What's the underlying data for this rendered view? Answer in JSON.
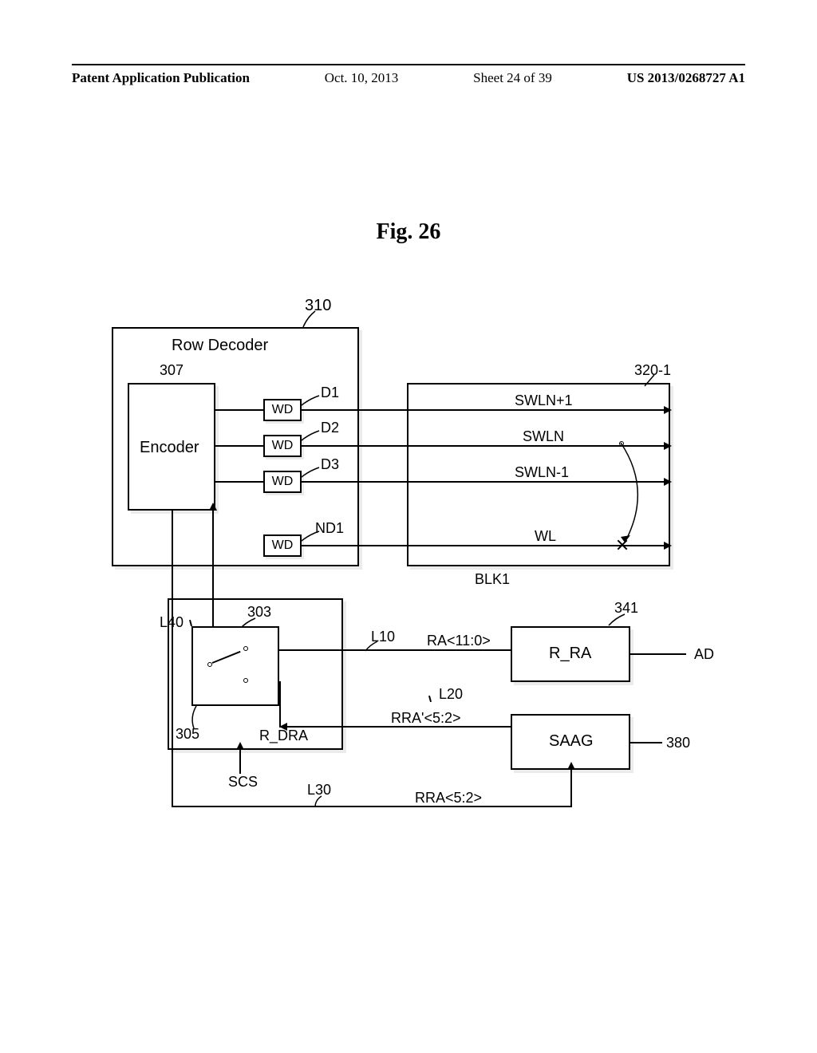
{
  "header": {
    "left": "Patent Application Publication",
    "date": "Oct. 10, 2013",
    "sheet": "Sheet 24 of 39",
    "right": "US 2013/0268727 A1"
  },
  "figure_title": "Fig. 26",
  "blocks": {
    "row_decoder": {
      "ref": "310",
      "title": "Row Decoder"
    },
    "encoder": {
      "ref": "307",
      "title": "Encoder"
    },
    "wd_label": "WD",
    "wd_refs": {
      "d1": "D1",
      "d2": "D2",
      "d3": "D3",
      "nd1": "ND1"
    },
    "blk1": {
      "ref": "320-1",
      "name": "BLK1",
      "lines": [
        "SWLN+1",
        "SWLN",
        "SWLN-1",
        "WL"
      ]
    },
    "r_dra": {
      "ref": "303",
      "inner_ref": "305",
      "name": "R_DRA"
    },
    "r_ra": {
      "ref": "341",
      "name": "R_RA",
      "out": "AD"
    },
    "saag": {
      "ref": "380",
      "name": "SAAG"
    }
  },
  "signals": {
    "l40": "L40",
    "l10": "L10",
    "ra": "RA<11:0>",
    "l20": "L20",
    "rra_prime": "RRA'<5:2>",
    "l30": "L30",
    "rra": "RRA<5:2>",
    "scs": "SCS"
  }
}
